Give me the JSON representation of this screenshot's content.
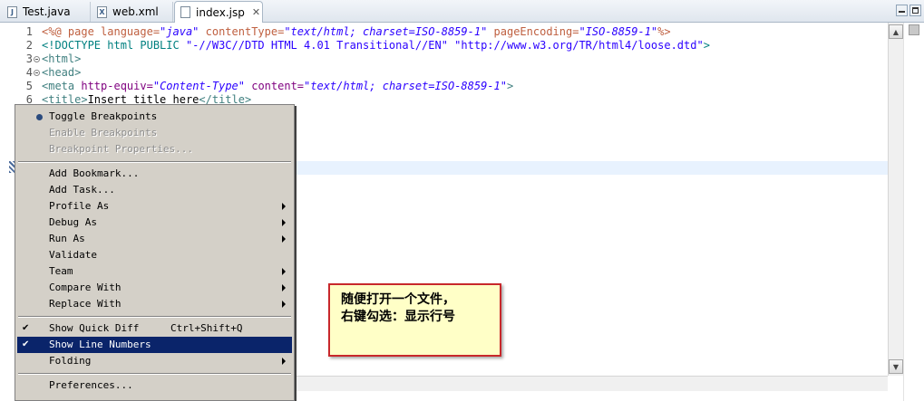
{
  "tabs": [
    {
      "label": "Test.java",
      "icon": "java-file-icon",
      "glyph": "J",
      "active": false
    },
    {
      "label": "web.xml",
      "icon": "xml-file-icon",
      "glyph": "X",
      "active": false
    },
    {
      "label": "index.jsp",
      "icon": "jsp-file-icon",
      "glyph": "",
      "active": true
    }
  ],
  "tab_close_glyph": "✕",
  "editor": {
    "line_numbers": [
      "1",
      "2",
      "3",
      "4",
      "5",
      "6"
    ],
    "code": {
      "l1": [
        "<%@ page language=",
        "\"java\"",
        " contentType=",
        "\"text/html; charset=ISO-8859-1\"",
        " pageEncoding=",
        "\"ISO-8859-1\"",
        "%>"
      ],
      "l2": [
        "<!DOCTYPE html PUBLIC ",
        "\"-//W3C//DTD HTML 4.01 Transitional//EN\"",
        " ",
        "\"http://www.w3.org/TR/html4/loose.dtd\"",
        ">"
      ],
      "l3": [
        "<html>"
      ],
      "l4": [
        "<head>"
      ],
      "l5": [
        "<meta ",
        "http-equiv=",
        "\"Content-Type\"",
        " content=",
        "\"text/html; charset=ISO-8859-1\"",
        ">"
      ],
      "l6": [
        "<title>",
        "Insert title here",
        "</title>"
      ]
    }
  },
  "scroll_up_glyph": "▲",
  "scroll_down_glyph": "▼",
  "context_menu": {
    "items": [
      {
        "label": "Toggle Breakpoints"
      },
      {
        "label": "Enable Breakpoints"
      },
      {
        "label": "Breakpoint Properties..."
      },
      {
        "label": "Add Bookmark..."
      },
      {
        "label": "Add Task..."
      },
      {
        "label": "Profile As"
      },
      {
        "label": "Debug As"
      },
      {
        "label": "Run As"
      },
      {
        "label": "Validate"
      },
      {
        "label": "Team"
      },
      {
        "label": "Compare With"
      },
      {
        "label": "Replace With"
      },
      {
        "label": "Show Quick Diff",
        "accel": "Ctrl+Shift+Q"
      },
      {
        "label": "Show Line Numbers"
      },
      {
        "label": "Folding"
      },
      {
        "label": "Preferences..."
      }
    ],
    "check_glyph": "✔"
  },
  "note": {
    "line1": "随便打开一个文件，",
    "line2": "右键勾选：显示行号"
  },
  "colors": {
    "selection": "#0a246a",
    "menu_bg": "#d4d0c8",
    "note_border": "#c8282b",
    "note_bg": "#ffffc7"
  }
}
